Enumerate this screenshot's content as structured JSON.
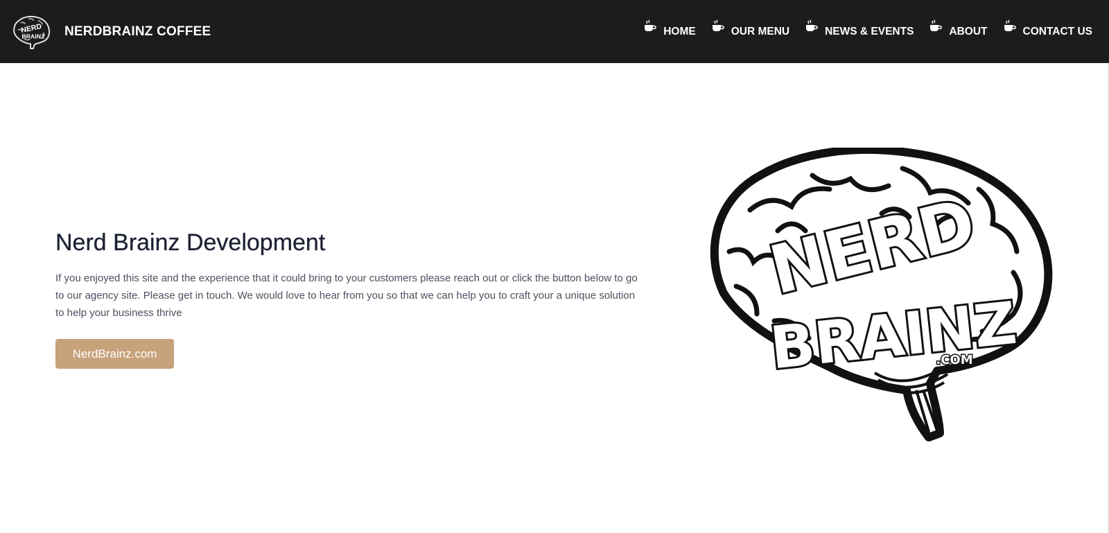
{
  "navbar": {
    "brand_name": "NERDBRAINZ COFFEE",
    "links": [
      {
        "label": "HOME",
        "icon": "coffee-cup-icon"
      },
      {
        "label": "OUR MENU",
        "icon": "coffee-cup-icon"
      },
      {
        "label": "NEWS & EVENTS",
        "icon": "coffee-cup-icon"
      },
      {
        "label": "ABOUT",
        "icon": "coffee-cup-icon"
      },
      {
        "label": "CONTACT US",
        "icon": "coffee-cup-icon"
      }
    ]
  },
  "hero": {
    "title": "Nerd Brainz Development",
    "description": "If you enjoyed this site and the experience that it could bring to your customers please reach out or click the button below to go to our agency site. Please get in touch. We would love to hear from you so that we can help you to craft your a unique solution to help your business thrive",
    "button_label": "NerdBrainz.com"
  },
  "logo": {
    "line1": "NERD",
    "line2": "BRAINZ",
    "suffix": ".COM",
    "small_line1": "NERD",
    "small_line2": "BRAINZ"
  },
  "colors": {
    "navbar_bg": "#1c1c1c",
    "button_bg": "#c7a27a",
    "title": "#1d2234",
    "body_text": "#4b5160"
  }
}
